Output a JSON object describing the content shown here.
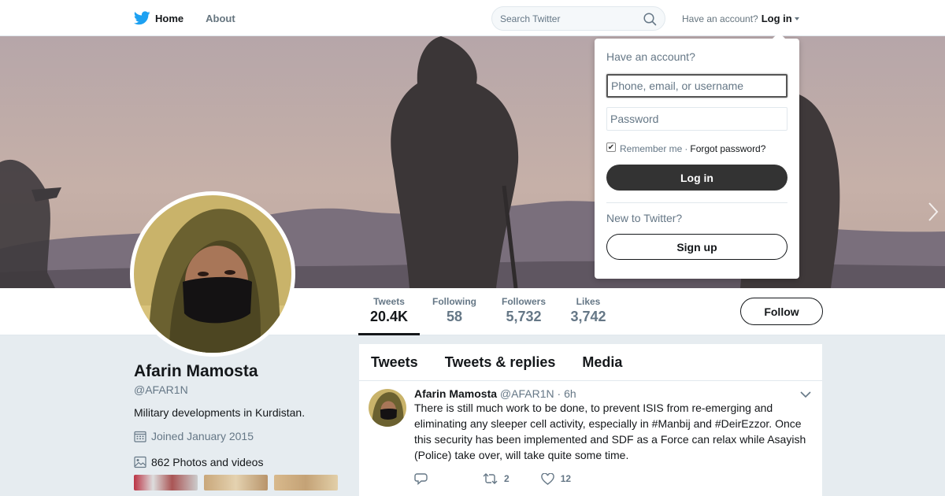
{
  "nav": {
    "home_label": "Home",
    "about_label": "About",
    "search_placeholder": "Search Twitter",
    "have_account": "Have an account?",
    "login_label": "Log in",
    "logo_icon": "twitter-bird-icon",
    "brand_color": "#1da1f2"
  },
  "login_dropdown": {
    "title": "Have an account?",
    "username_placeholder": "Phone, email, or username",
    "password_placeholder": "Password",
    "remember_label": "Remember me",
    "separator": "·",
    "forgot_label": "Forgot password?",
    "remember_checked": true,
    "login_button": "Log in",
    "new_label": "New to Twitter?",
    "signup_button": "Sign up"
  },
  "profile": {
    "name": "Afarin Mamosta",
    "handle": "@AFAR1N",
    "bio": "Military developments in Kurdistan.",
    "joined": "Joined January 2015",
    "photos": "862 Photos and videos"
  },
  "stats": [
    {
      "label": "Tweets",
      "value": "20.4K"
    },
    {
      "label": "Following",
      "value": "58"
    },
    {
      "label": "Followers",
      "value": "5,732"
    },
    {
      "label": "Likes",
      "value": "3,742"
    }
  ],
  "follow_button": "Follow",
  "timeline": {
    "tabs": [
      "Tweets",
      "Tweets & replies",
      "Media"
    ],
    "tweet": {
      "name": "Afarin Mamosta",
      "handle": "@AFAR1N",
      "separator": "·",
      "time": "6h",
      "text_1": "There is still much work to be done, to prevent ISIS from re-emerging and eliminating any sleeper cell activity, especially in ",
      "hashtag_1": "#Manbij",
      "text_2": " and ",
      "hashtag_2": "#DeirEzzor",
      "text_3": ". Once this security has been implemented and SDF as a Force can relax while Asayish (Police) take over, will take quite some time.",
      "retweets": "2",
      "likes": "12"
    }
  }
}
